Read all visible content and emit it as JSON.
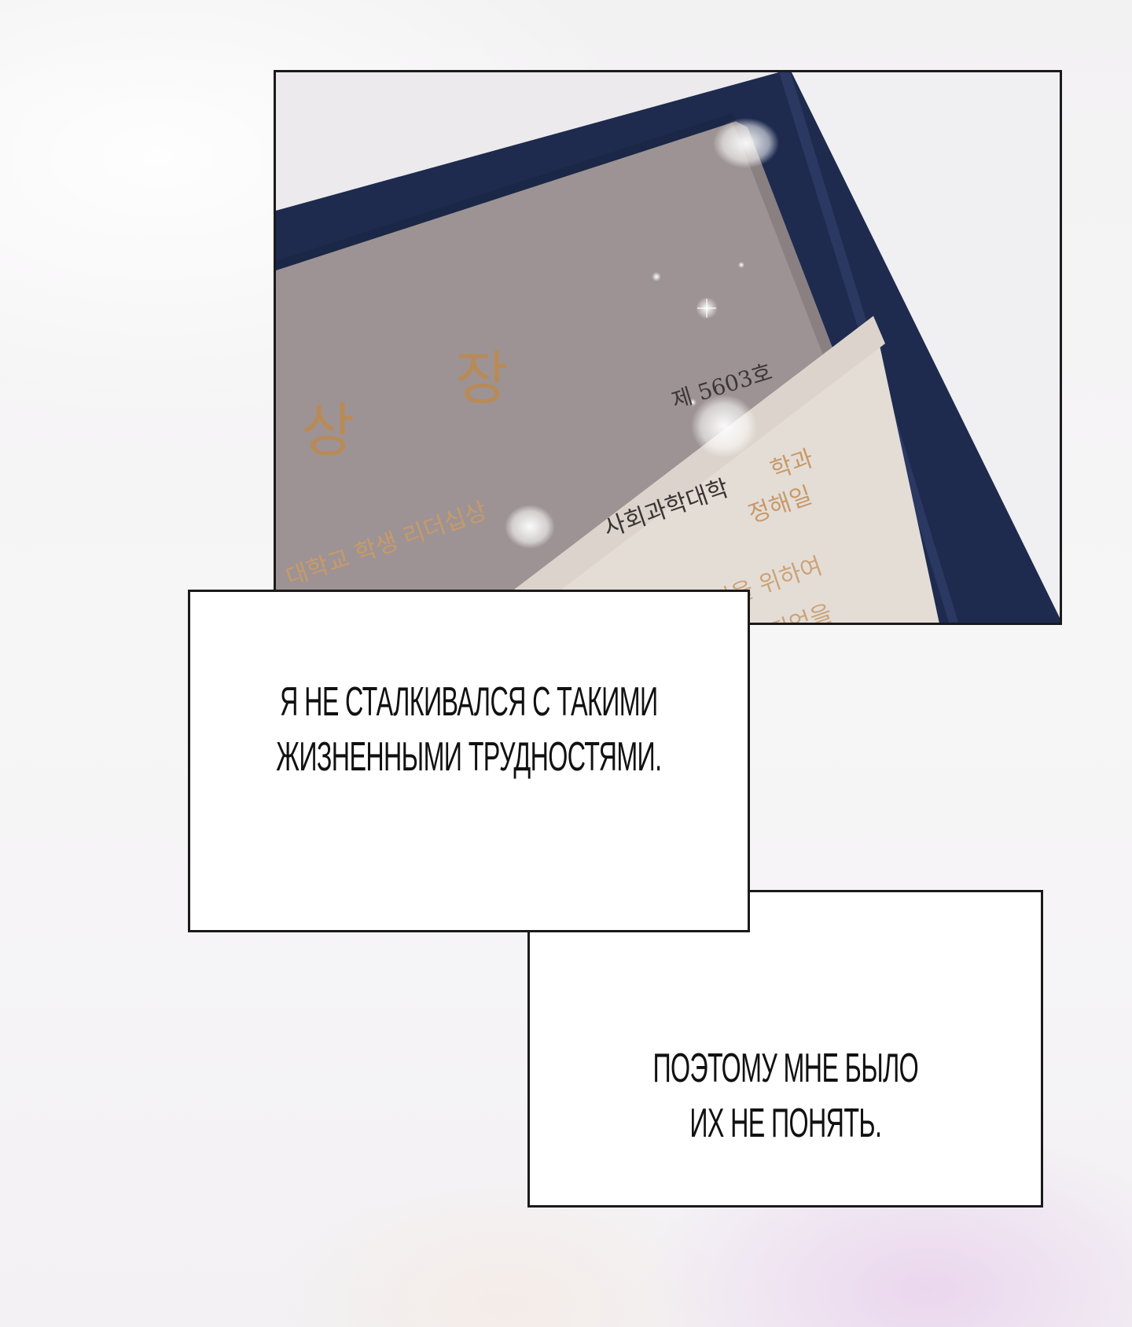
{
  "certificate": {
    "title_left": "상",
    "title_right": "장",
    "number": "제 5603호",
    "line_university": "대학교 학생 리더십상",
    "line_college": "사회과학대학",
    "line_department": "학과",
    "line_name": "정해일",
    "line_development": "발전을 위하여",
    "line_became": "되었을"
  },
  "speech": {
    "first": {
      "line1": "Я НЕ СТАЛКИВАЛСЯ С ТАКИМИ",
      "line2": "ЖИЗНЕННЫМИ ТРУДНОСТЯМИ."
    },
    "second": {
      "line1": "ПОЭТОМУ МНЕ БЫЛО",
      "line2": "ИХ НЕ ПОНЯТЬ."
    }
  }
}
